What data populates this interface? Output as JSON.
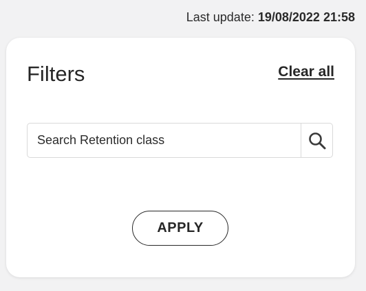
{
  "header": {
    "last_update_label": "Last update:",
    "last_update_value": "19/08/2022 21:58"
  },
  "filters": {
    "title": "Filters",
    "clear_all_label": "Clear all",
    "search": {
      "value": "",
      "placeholder": "Search Retention class",
      "icon": "search-icon"
    },
    "apply_label": "APPLY"
  },
  "colors": {
    "background": "#f2f2f3",
    "card": "#ffffff",
    "text": "#262626",
    "border": "#d9d9d9"
  }
}
